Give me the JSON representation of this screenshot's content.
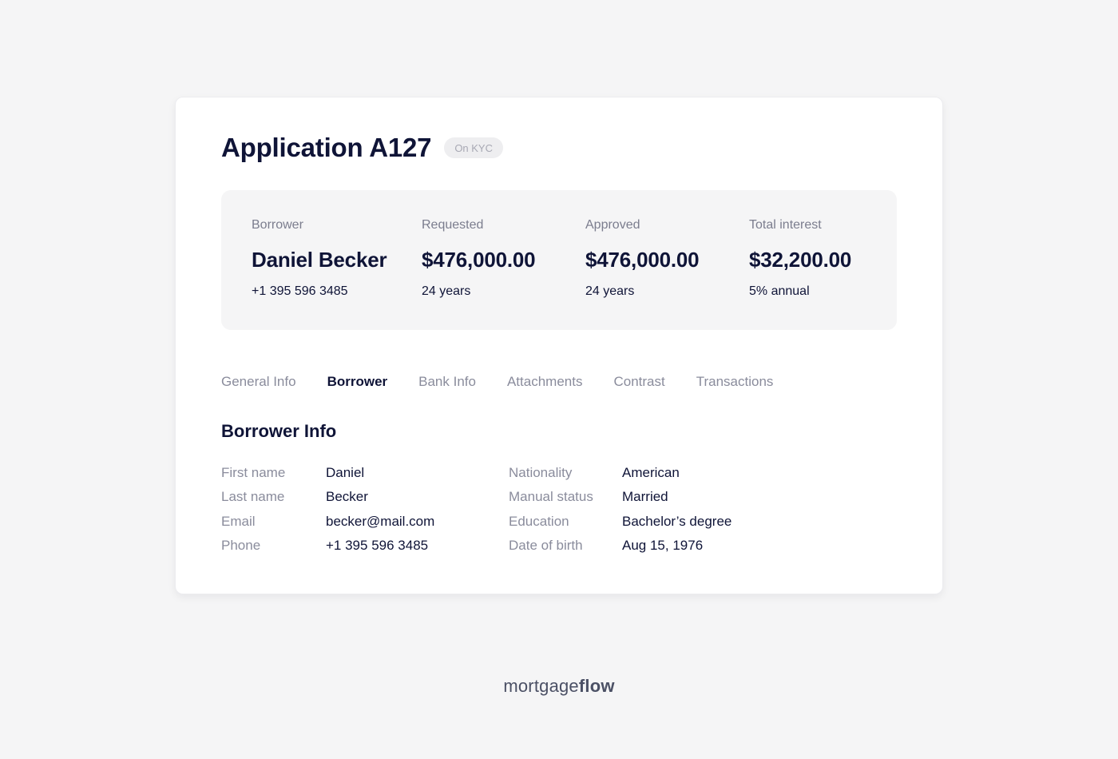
{
  "application": {
    "title": "Application A127",
    "status_badge": "On KYC"
  },
  "summary": [
    {
      "label": "Borrower",
      "value": "Daniel Becker",
      "sub": "+1 395 596 3485"
    },
    {
      "label": "Requested",
      "value": "$476,000.00",
      "sub": "24 years"
    },
    {
      "label": "Approved",
      "value": "$476,000.00",
      "sub": "24 years"
    },
    {
      "label": "Total interest",
      "value": "$32,200.00",
      "sub": "5% annual"
    }
  ],
  "tabs": [
    {
      "label": "General Info",
      "active": false
    },
    {
      "label": "Borrower",
      "active": true
    },
    {
      "label": "Bank Info",
      "active": false
    },
    {
      "label": "Attachments",
      "active": false
    },
    {
      "label": "Contrast",
      "active": false
    },
    {
      "label": "Transactions",
      "active": false
    }
  ],
  "borrower_info": {
    "title": "Borrower Info",
    "left": [
      {
        "label": "First name",
        "value": "Daniel"
      },
      {
        "label": "Last name",
        "value": "Becker"
      },
      {
        "label": "Email",
        "value": "becker@mail.com"
      },
      {
        "label": "Phone",
        "value": "+1 395 596 3485"
      }
    ],
    "right": [
      {
        "label": "Nationality",
        "value": "American"
      },
      {
        "label": "Manual status",
        "value": "Married"
      },
      {
        "label": "Education",
        "value": "Bachelor’s degree"
      },
      {
        "label": "Date of birth",
        "value": "Aug 15, 1976"
      }
    ]
  },
  "footer": {
    "brand_regular": "mortgage",
    "brand_bold": "flow"
  },
  "colors": {
    "background": "#f5f5f6",
    "card": "#ffffff",
    "text_primary": "#0f1437",
    "text_secondary": "#8a8c9c",
    "badge_bg": "#eeeef0"
  }
}
